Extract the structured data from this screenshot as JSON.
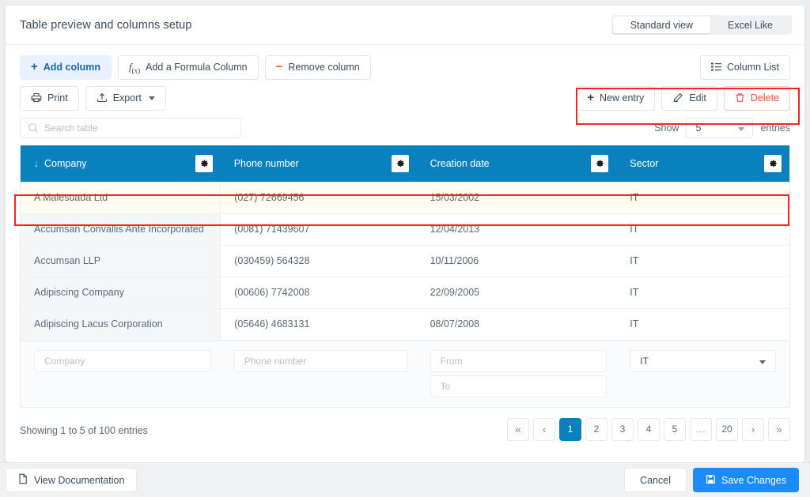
{
  "header": {
    "title": "Table preview and columns setup",
    "views": [
      {
        "label": "Standard view",
        "active": true
      },
      {
        "label": "Excel Like",
        "active": false
      }
    ]
  },
  "toolbar": {
    "add_column": "Add column",
    "formula_column": "Add a Formula Column",
    "remove_column": "Remove column",
    "print": "Print",
    "export": "Export",
    "column_list": "Column List",
    "new_entry": "New entry",
    "edit": "Edit",
    "delete": "Delete"
  },
  "search": {
    "placeholder": "Search table"
  },
  "show_entries": {
    "prefix": "Show",
    "value": "5",
    "suffix": "entries"
  },
  "table": {
    "columns": [
      {
        "label": "Company",
        "sorted": true,
        "sort_arrow": "↓"
      },
      {
        "label": "Phone number",
        "sorted": false,
        "sort_arrow": ""
      },
      {
        "label": "Creation date",
        "sorted": false,
        "sort_arrow": ""
      },
      {
        "label": "Sector",
        "sorted": false,
        "sort_arrow": ""
      }
    ],
    "rows": [
      {
        "selected": true,
        "company": "A Malesuada Ltd",
        "phone": "(027) 72669456",
        "creation_date": "15/03/2002",
        "sector": "IT"
      },
      {
        "selected": false,
        "company": "Accumsan Convallis Ante Incorporated",
        "phone": "(0081) 71439607",
        "creation_date": "12/04/2013",
        "sector": "IT"
      },
      {
        "selected": false,
        "company": "Accumsan LLP",
        "phone": "(030459) 564328",
        "creation_date": "10/11/2006",
        "sector": "IT"
      },
      {
        "selected": false,
        "company": "Adipiscing Company",
        "phone": "(00606) 7742008",
        "creation_date": "22/09/2005",
        "sector": "IT"
      },
      {
        "selected": false,
        "company": "Adipiscing Lacus Corporation",
        "phone": "(05646) 4683131",
        "creation_date": "08/07/2008",
        "sector": "IT"
      }
    ],
    "filters": {
      "company_placeholder": "Company",
      "phone_placeholder": "Phone number",
      "date_from_placeholder": "From",
      "date_to_placeholder": "To",
      "sector_value": "IT"
    }
  },
  "footer": {
    "showing": "Showing 1 to 5 of 100 entries",
    "pages": [
      {
        "label": "«",
        "type": "arrow",
        "active": false
      },
      {
        "label": "‹",
        "type": "arrow",
        "active": false
      },
      {
        "label": "1",
        "type": "page",
        "active": true
      },
      {
        "label": "2",
        "type": "page",
        "active": false
      },
      {
        "label": "3",
        "type": "page",
        "active": false
      },
      {
        "label": "4",
        "type": "page",
        "active": false
      },
      {
        "label": "5",
        "type": "page",
        "active": false
      },
      {
        "label": "...",
        "type": "dots",
        "active": false
      },
      {
        "label": "20",
        "type": "page",
        "active": false
      },
      {
        "label": "›",
        "type": "arrow",
        "active": false
      },
      {
        "label": "»",
        "type": "arrow",
        "active": false
      }
    ]
  },
  "bottom_bar": {
    "view_documentation": "View Documentation",
    "cancel": "Cancel",
    "save_changes": "Save Changes"
  },
  "colors": {
    "header_blue": "#0881be",
    "selected_row": "#fefbf2",
    "save_blue": "#1a8cff",
    "danger_red": "#f0483c",
    "annotation_red": "#fb2222"
  }
}
